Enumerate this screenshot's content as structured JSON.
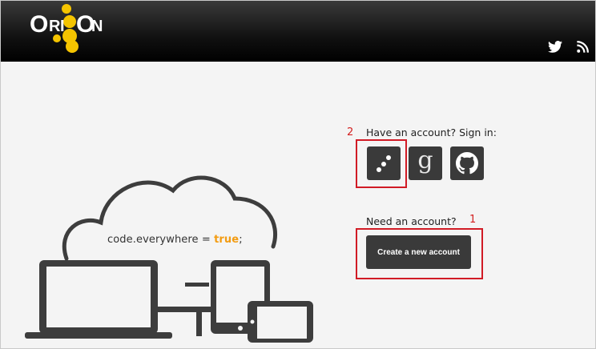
{
  "header": {
    "logo_text": "ORION",
    "social": [
      {
        "name": "twitter-icon"
      },
      {
        "name": "rss-icon"
      }
    ]
  },
  "hero": {
    "tagline_code": "code.everywhere",
    "tagline_eq": " = ",
    "tagline_true": "true",
    "tagline_end": ";"
  },
  "signin": {
    "label": "Have an account? Sign in:",
    "providers": [
      "orion-icon",
      "google-icon",
      "github-icon"
    ]
  },
  "signup": {
    "label": "Need an account?",
    "button": "Create a new account"
  },
  "annotations": {
    "one": "1",
    "two": "2"
  },
  "colors": {
    "accent": "#f5c400",
    "highlight": "#d11b25",
    "button_bg": "#3a3a3a"
  }
}
